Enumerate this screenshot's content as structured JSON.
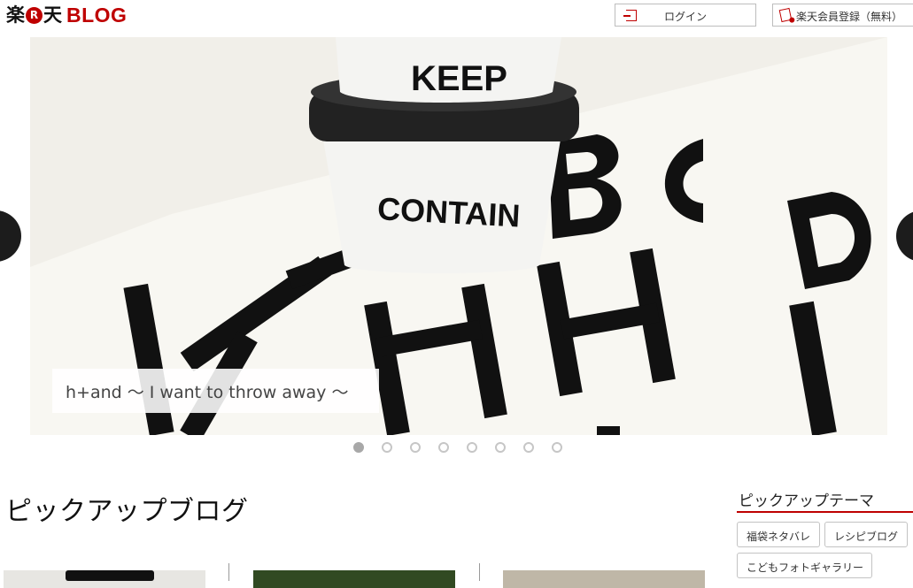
{
  "header": {
    "logo_kanji_left": "楽",
    "logo_r": "R",
    "logo_kanji_right": "天",
    "logo_blog": "BLOG",
    "login_label": "ログイン",
    "register_label": "楽天会員登録（無料）"
  },
  "slider": {
    "caption": "h+and ～ I want to throw away ～",
    "image_texts": {
      "cup_top": "KEEP",
      "cup_bottom": "CONTAIN"
    },
    "total_slides": 8,
    "active_slide": 1
  },
  "pickup_blog": {
    "title": "ピックアップブログ"
  },
  "pickup_theme": {
    "title": "ピックアップテーマ",
    "tags": [
      "福袋ネタバレ",
      "レシピブログ",
      "こどもフォトギャラリー"
    ]
  },
  "colors": {
    "brand_red": "#bf0000",
    "dot_active": "#a8a8a8",
    "dot_inactive": "#c6c6c6"
  }
}
